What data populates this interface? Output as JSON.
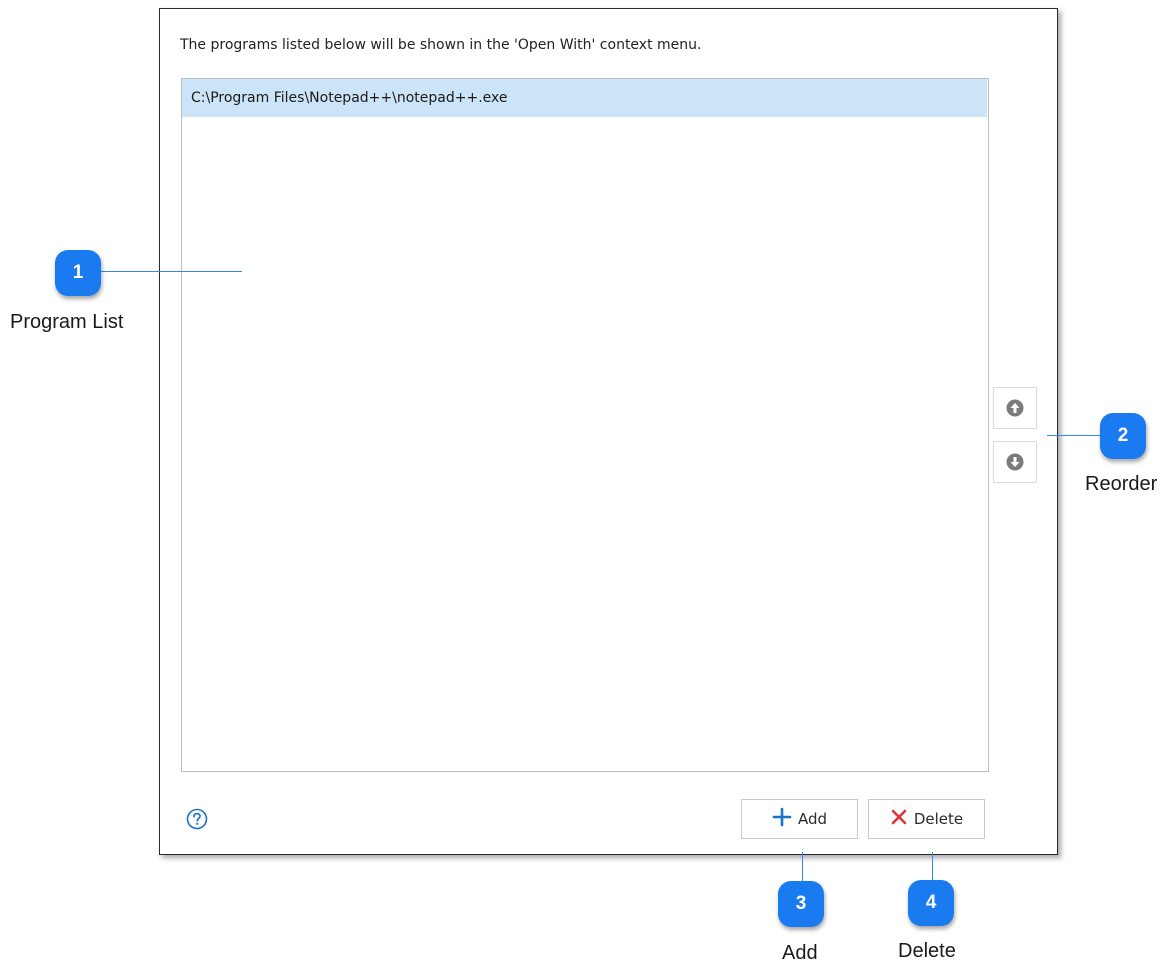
{
  "dialog": {
    "description": "The programs listed below will be shown in the 'Open With' context menu.",
    "programs": [
      "C:\\Program Files\\Notepad++\\notepad++.exe"
    ],
    "buttons": {
      "add_label": "Add",
      "delete_label": "Delete"
    },
    "icons": {
      "move_up": "arrow-up-circle-icon",
      "move_down": "arrow-down-circle-icon",
      "help": "question-circle-icon",
      "add": "plus-icon",
      "delete": "x-icon"
    }
  },
  "callouts": [
    {
      "number": "1",
      "label": "Program List"
    },
    {
      "number": "2",
      "label": "Reorder"
    },
    {
      "number": "3",
      "label": "Add"
    },
    {
      "number": "4",
      "label": "Delete"
    }
  ],
  "colors": {
    "badge": "#1a7af0",
    "leader_line": "#2e8ce6",
    "selected_row": "#cce4f7",
    "delete_x": "#e0332f",
    "add_plus": "#1a73c7"
  }
}
